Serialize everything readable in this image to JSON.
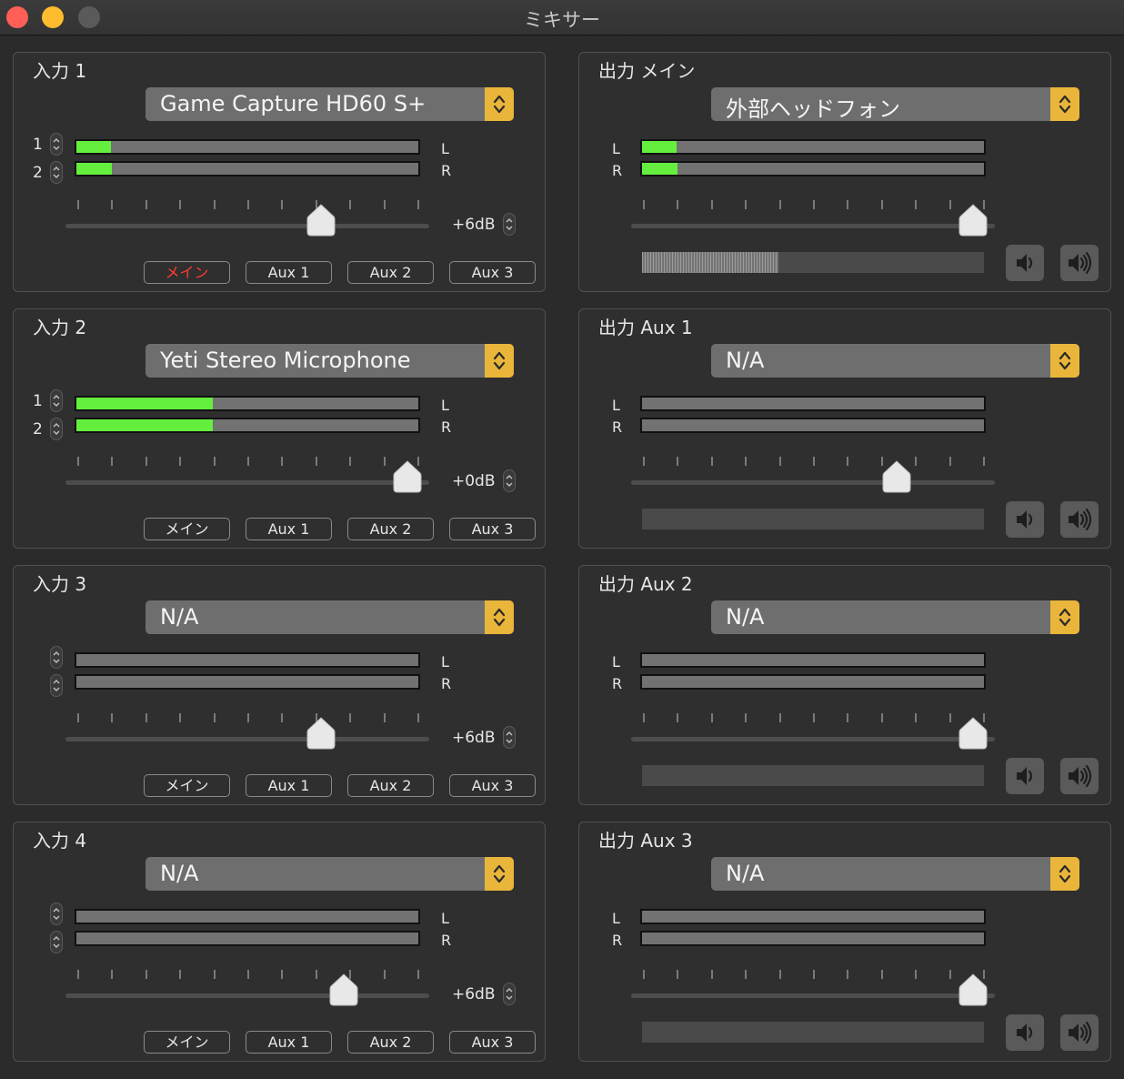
{
  "window": {
    "title": "ミキサー"
  },
  "colors": {
    "accent": "#e9b53a",
    "meter_green": "#64ef3e",
    "active_red": "#ff3b30"
  },
  "inputs": [
    {
      "title": "入力 1",
      "device": "Game Capture HD60 S+",
      "channels": [
        "1",
        "2"
      ],
      "meter_left": 0.1,
      "meter_right": 0.105,
      "slider_level": 0.73,
      "gain": "+6dB",
      "routes": [
        {
          "label": "メイン",
          "active": true
        },
        {
          "label": "Aux 1",
          "active": false
        },
        {
          "label": "Aux 2",
          "active": false
        },
        {
          "label": "Aux 3",
          "active": false
        }
      ]
    },
    {
      "title": "入力 2",
      "device": "Yeti Stereo Microphone",
      "channels": [
        "1",
        "2"
      ],
      "meter_left": 0.4,
      "meter_right": 0.4,
      "slider_level": 1.0,
      "gain": "+0dB",
      "routes": [
        {
          "label": "メイン",
          "active": false
        },
        {
          "label": "Aux 1",
          "active": false
        },
        {
          "label": "Aux 2",
          "active": false
        },
        {
          "label": "Aux 3",
          "active": false
        }
      ]
    },
    {
      "title": "入力 3",
      "device": "N/A",
      "channels": [
        "",
        ""
      ],
      "meter_left": 0,
      "meter_right": 0,
      "slider_level": 0.73,
      "gain": "+6dB",
      "routes": [
        {
          "label": "メイン",
          "active": false
        },
        {
          "label": "Aux 1",
          "active": false
        },
        {
          "label": "Aux 2",
          "active": false
        },
        {
          "label": "Aux 3",
          "active": false
        }
      ]
    },
    {
      "title": "入力 4",
      "device": "N/A",
      "channels": [
        "",
        ""
      ],
      "meter_left": 0,
      "meter_right": 0,
      "slider_level": 0.8,
      "gain": "+6dB",
      "routes": [
        {
          "label": "メイン",
          "active": false
        },
        {
          "label": "Aux 1",
          "active": false
        },
        {
          "label": "Aux 2",
          "active": false
        },
        {
          "label": "Aux 3",
          "active": false
        }
      ]
    }
  ],
  "outputs": [
    {
      "title": "出力 メイン",
      "device": "外部ヘッドフォン",
      "meter_left": 0.1,
      "meter_right": 0.105,
      "slider_level": 1.0,
      "volume_level": 0.4
    },
    {
      "title": "出力 Aux 1",
      "device": "N/A",
      "meter_left": 0,
      "meter_right": 0,
      "slider_level": 0.76,
      "volume_level": 0
    },
    {
      "title": "出力 Aux 2",
      "device": "N/A",
      "meter_left": 0,
      "meter_right": 0,
      "slider_level": 1.0,
      "volume_level": 0
    },
    {
      "title": "出力 Aux 3",
      "device": "N/A",
      "meter_left": 0,
      "meter_right": 0,
      "slider_level": 1.0,
      "volume_level": 0
    }
  ],
  "labels": {
    "left": "L",
    "right": "R"
  },
  "icons": {
    "volume_down": "speaker-low-icon",
    "volume_up": "speaker-high-icon",
    "dropdown": "chevron-updown-icon"
  }
}
